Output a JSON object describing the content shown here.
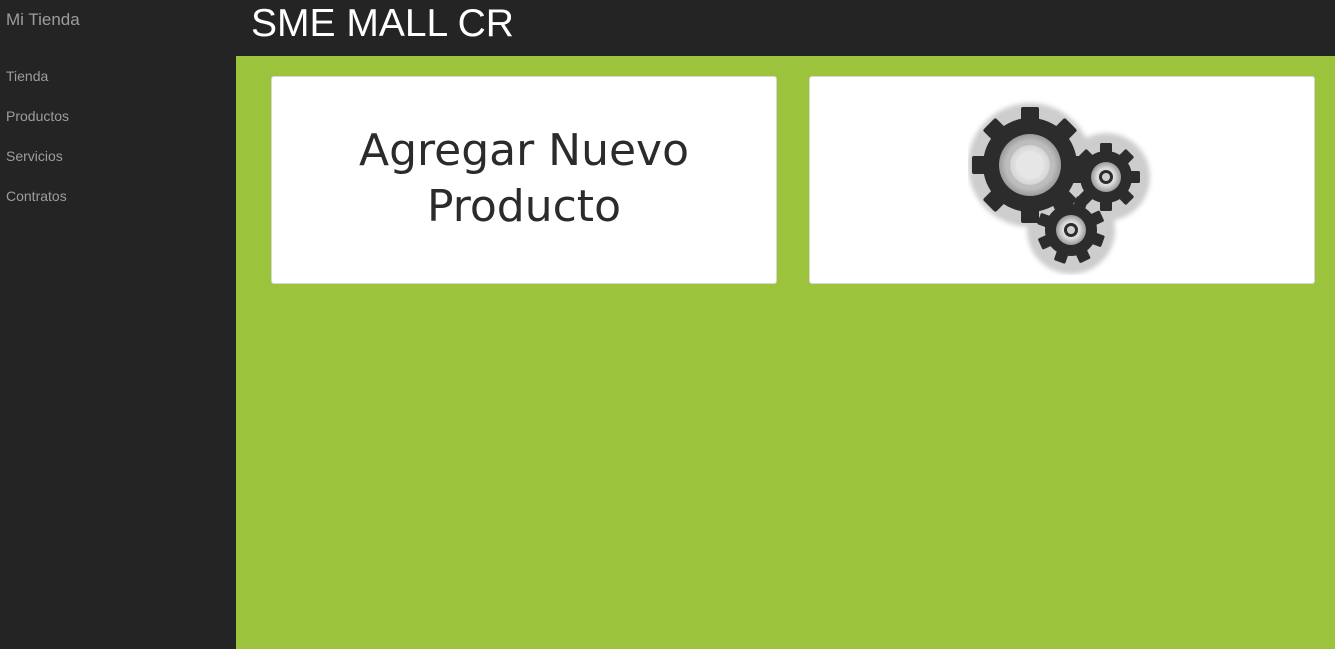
{
  "sidebar": {
    "brand": "Mi Tienda",
    "items": [
      {
        "label": "Tienda"
      },
      {
        "label": "Productos"
      },
      {
        "label": "Servicios"
      },
      {
        "label": "Contratos"
      }
    ]
  },
  "header": {
    "title": "SME MALL CR"
  },
  "cards": {
    "add_product": {
      "line1": "Agregar Nuevo",
      "line2": "Producto"
    },
    "settings": {
      "icon": "gears-icon"
    }
  },
  "colors": {
    "sidebar_bg": "#242424",
    "main_bg": "#9bc33b",
    "card_bg": "#ffffff",
    "nav_text": "#9d9d9d"
  }
}
